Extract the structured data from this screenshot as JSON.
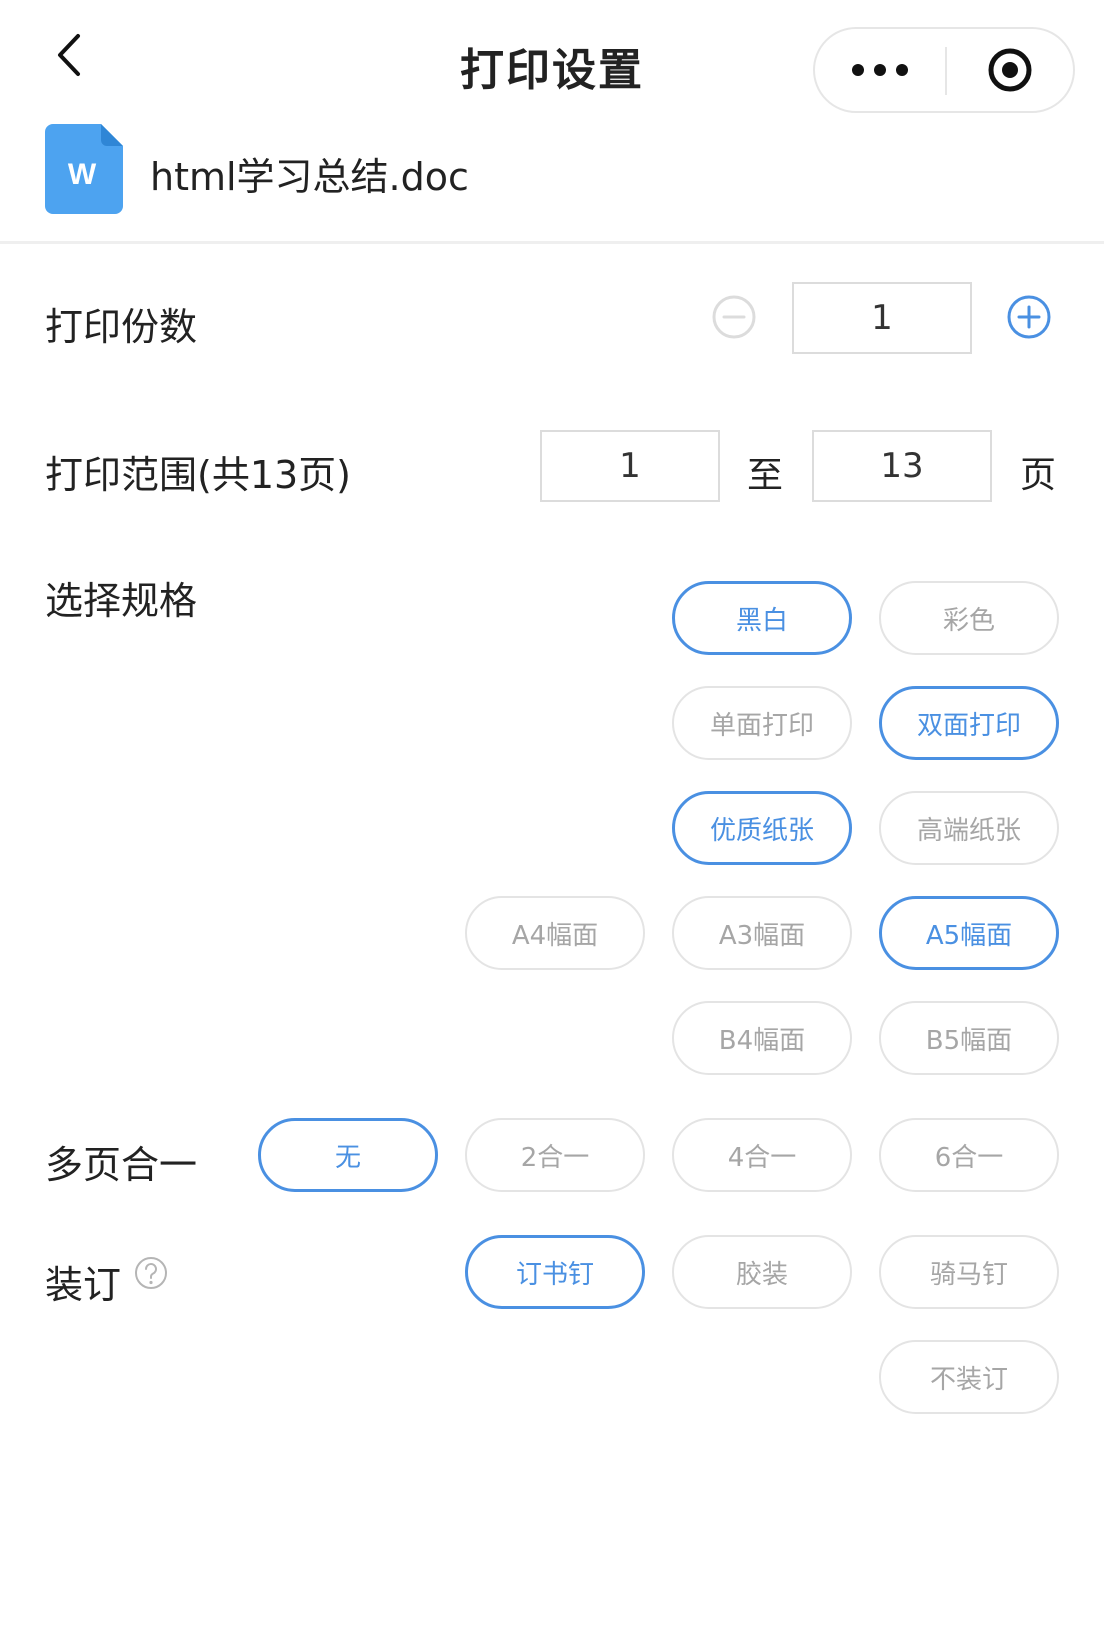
{
  "header": {
    "title": "打印设置"
  },
  "file": {
    "icon_letter": "W",
    "name": "html学习总结.doc"
  },
  "copies": {
    "label": "打印份数",
    "value": "1"
  },
  "range": {
    "label": "打印范围(共13页)",
    "from": "1",
    "to_word": "至",
    "to": "13",
    "unit": "页"
  },
  "spec": {
    "label": "选择规格",
    "color_options": [
      {
        "label": "黑白",
        "active": true
      },
      {
        "label": "彩色",
        "active": false
      }
    ],
    "side_options": [
      {
        "label": "单面打印",
        "active": false
      },
      {
        "label": "双面打印",
        "active": true
      }
    ],
    "paper_options": [
      {
        "label": "优质纸张",
        "active": true
      },
      {
        "label": "高端纸张",
        "active": false
      }
    ],
    "size_options": [
      {
        "label": "A4幅面",
        "active": false
      },
      {
        "label": "A3幅面",
        "active": false
      },
      {
        "label": "A5幅面",
        "active": true
      },
      {
        "label": "B4幅面",
        "active": false
      },
      {
        "label": "B5幅面",
        "active": false
      }
    ]
  },
  "nup": {
    "label": "多页合一",
    "options": [
      {
        "label": "无",
        "active": true
      },
      {
        "label": "2合一",
        "active": false
      },
      {
        "label": "4合一",
        "active": false
      },
      {
        "label": "6合一",
        "active": false
      }
    ]
  },
  "binding": {
    "label": "装订",
    "options": [
      {
        "label": "订书钉",
        "active": true
      },
      {
        "label": "胶装",
        "active": false
      },
      {
        "label": "骑马钉",
        "active": false
      },
      {
        "label": "不装订",
        "active": false
      }
    ]
  },
  "colors": {
    "accent": "#4a90e2",
    "doc_icon": "#4da3f0",
    "inactive_text": "#a6a6a6"
  }
}
